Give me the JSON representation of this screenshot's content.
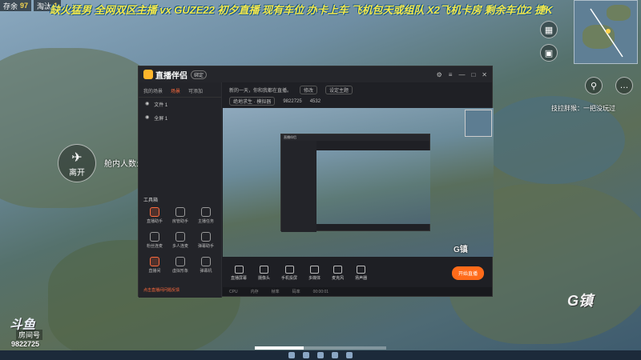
{
  "hud": {
    "alive_label": "存余",
    "alive_count": "97",
    "eliminated_label": "淘汰",
    "eliminated_count": "1"
  },
  "marquee": "缺火猛男 全网双区主播 vx GUZE22 初夕直播 现有车位 办卡上车 飞机包天或组队 X2飞机卡房 剩余车位2 捷K",
  "leave_button": "离开",
  "cabin_label": "舱内人数:1",
  "teammate_status": "技拉胖猴：一把没玩过",
  "app": {
    "name": "直播伴侣",
    "badge": "绑定",
    "sidebar_tabs": [
      "我的场景",
      "场景",
      "可添加"
    ],
    "active_tab_index": 1,
    "scenes": [
      "文件 1",
      "全屏 1"
    ],
    "tools_title": "工具箱",
    "tools": [
      {
        "label": "直播助手",
        "icon": "assistant-icon",
        "hot": true
      },
      {
        "label": "房管助手",
        "icon": "moderator-icon",
        "hot": false
      },
      {
        "label": "主播任务",
        "icon": "task-icon",
        "hot": false
      },
      {
        "label": "粉丝连麦",
        "icon": "fans-mic-icon",
        "hot": false
      },
      {
        "label": "多人连麦",
        "icon": "multi-mic-icon",
        "hot": false
      },
      {
        "label": "弹幕助手",
        "icon": "danmaku-icon",
        "hot": false
      },
      {
        "label": "直播间",
        "icon": "live-room-icon",
        "hot": true
      },
      {
        "label": "虚拟形象",
        "icon": "avatar-icon",
        "hot": false
      },
      {
        "label": "弹幕机",
        "icon": "danmaku-machine-icon",
        "hot": false
      }
    ],
    "sidebar_footer": "点击直播间问题反馈",
    "top_text": "新的一天，你和我都在直播。",
    "top_pill_1": "修改",
    "top_pill_2": "设定主题",
    "top_row2": [
      "绝地求生 · 模拟器",
      "9822725",
      "4532"
    ],
    "bottom_items": [
      "直播屏幕",
      "摄像头",
      "手机投屏",
      "多媒体",
      "麦克风",
      "扬声器"
    ],
    "start_button": "开始直播",
    "status_items": [
      "CPU",
      "内存",
      "帧率",
      "码率",
      "00:00:01"
    ]
  },
  "preview_town_label": "G镇",
  "watermark": {
    "brand": "斗鱼",
    "room_label": "房间号",
    "room_id": "9822725"
  },
  "map_town_label": "G镇",
  "playback": {
    "progress": 0.37
  }
}
